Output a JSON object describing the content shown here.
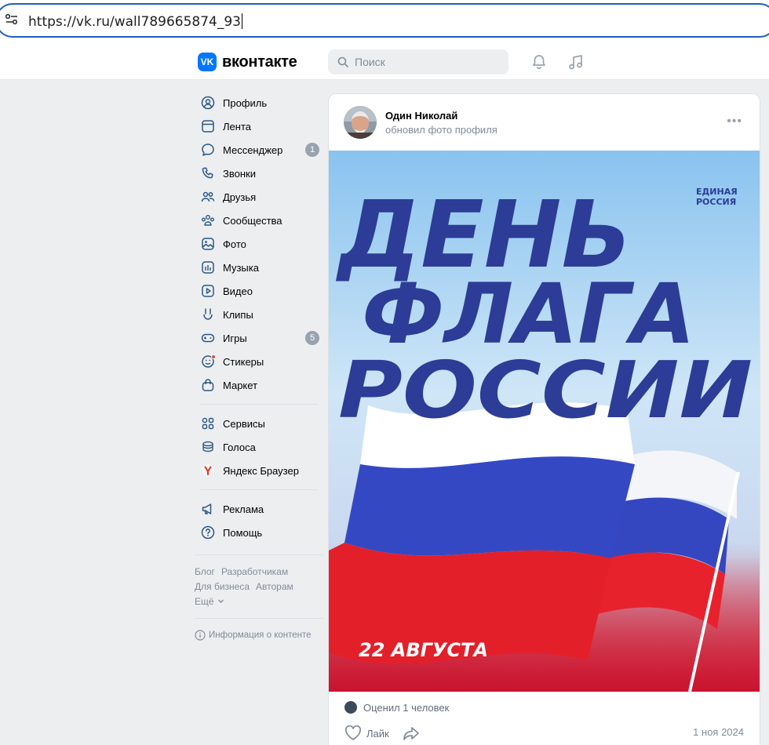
{
  "browser": {
    "url": "https://vk.ru/wall789665874_93"
  },
  "header": {
    "logo_mark": "VK",
    "logo_text": "вконтакте",
    "search_placeholder": "Поиск"
  },
  "nav": {
    "items": [
      {
        "label": "Профиль",
        "icon": "profile-icon"
      },
      {
        "label": "Лента",
        "icon": "feed-icon"
      },
      {
        "label": "Мессенджер",
        "icon": "messenger-icon",
        "badge": "1"
      },
      {
        "label": "Звонки",
        "icon": "phone-icon"
      },
      {
        "label": "Друзья",
        "icon": "friends-icon"
      },
      {
        "label": "Сообщества",
        "icon": "communities-icon"
      },
      {
        "label": "Фото",
        "icon": "photo-icon"
      },
      {
        "label": "Музыка",
        "icon": "music-icon"
      },
      {
        "label": "Видео",
        "icon": "video-icon"
      },
      {
        "label": "Клипы",
        "icon": "clips-icon"
      },
      {
        "label": "Игры",
        "icon": "games-icon",
        "badge": "5"
      },
      {
        "label": "Стикеры",
        "icon": "stickers-icon"
      },
      {
        "label": "Маркет",
        "icon": "market-icon"
      }
    ],
    "items2": [
      {
        "label": "Сервисы",
        "icon": "services-icon"
      },
      {
        "label": "Голоса",
        "icon": "votes-icon"
      },
      {
        "label": "Яндекс Браузер",
        "icon": "yandex-browser-icon"
      }
    ],
    "items3": [
      {
        "label": "Реклама",
        "icon": "ads-icon"
      },
      {
        "label": "Помощь",
        "icon": "help-icon"
      }
    ],
    "footer": [
      "Блог",
      "Разработчикам",
      "Для бизнеса",
      "Авторам",
      "Ещё"
    ],
    "content_info": "Информация о контенте"
  },
  "post": {
    "author": "Один Николай",
    "action": "обновил фото профиля",
    "image": {
      "line1": "ДЕНЬ",
      "line2": "ФЛАГА",
      "line3": "РОССИИ",
      "brand1": "ЕДИНАЯ",
      "brand2": "РОССИЯ",
      "date": "22 АВГУСТА"
    },
    "rated": "Оценил 1 человек",
    "like_label": "Лайк",
    "date": "1 ноя 2024"
  },
  "colors": {
    "accent": "#0077ff",
    "flag_white": "#ffffff",
    "flag_blue": "#2f43b8",
    "flag_red": "#e3202a",
    "title_blue": "#2d3c97"
  }
}
